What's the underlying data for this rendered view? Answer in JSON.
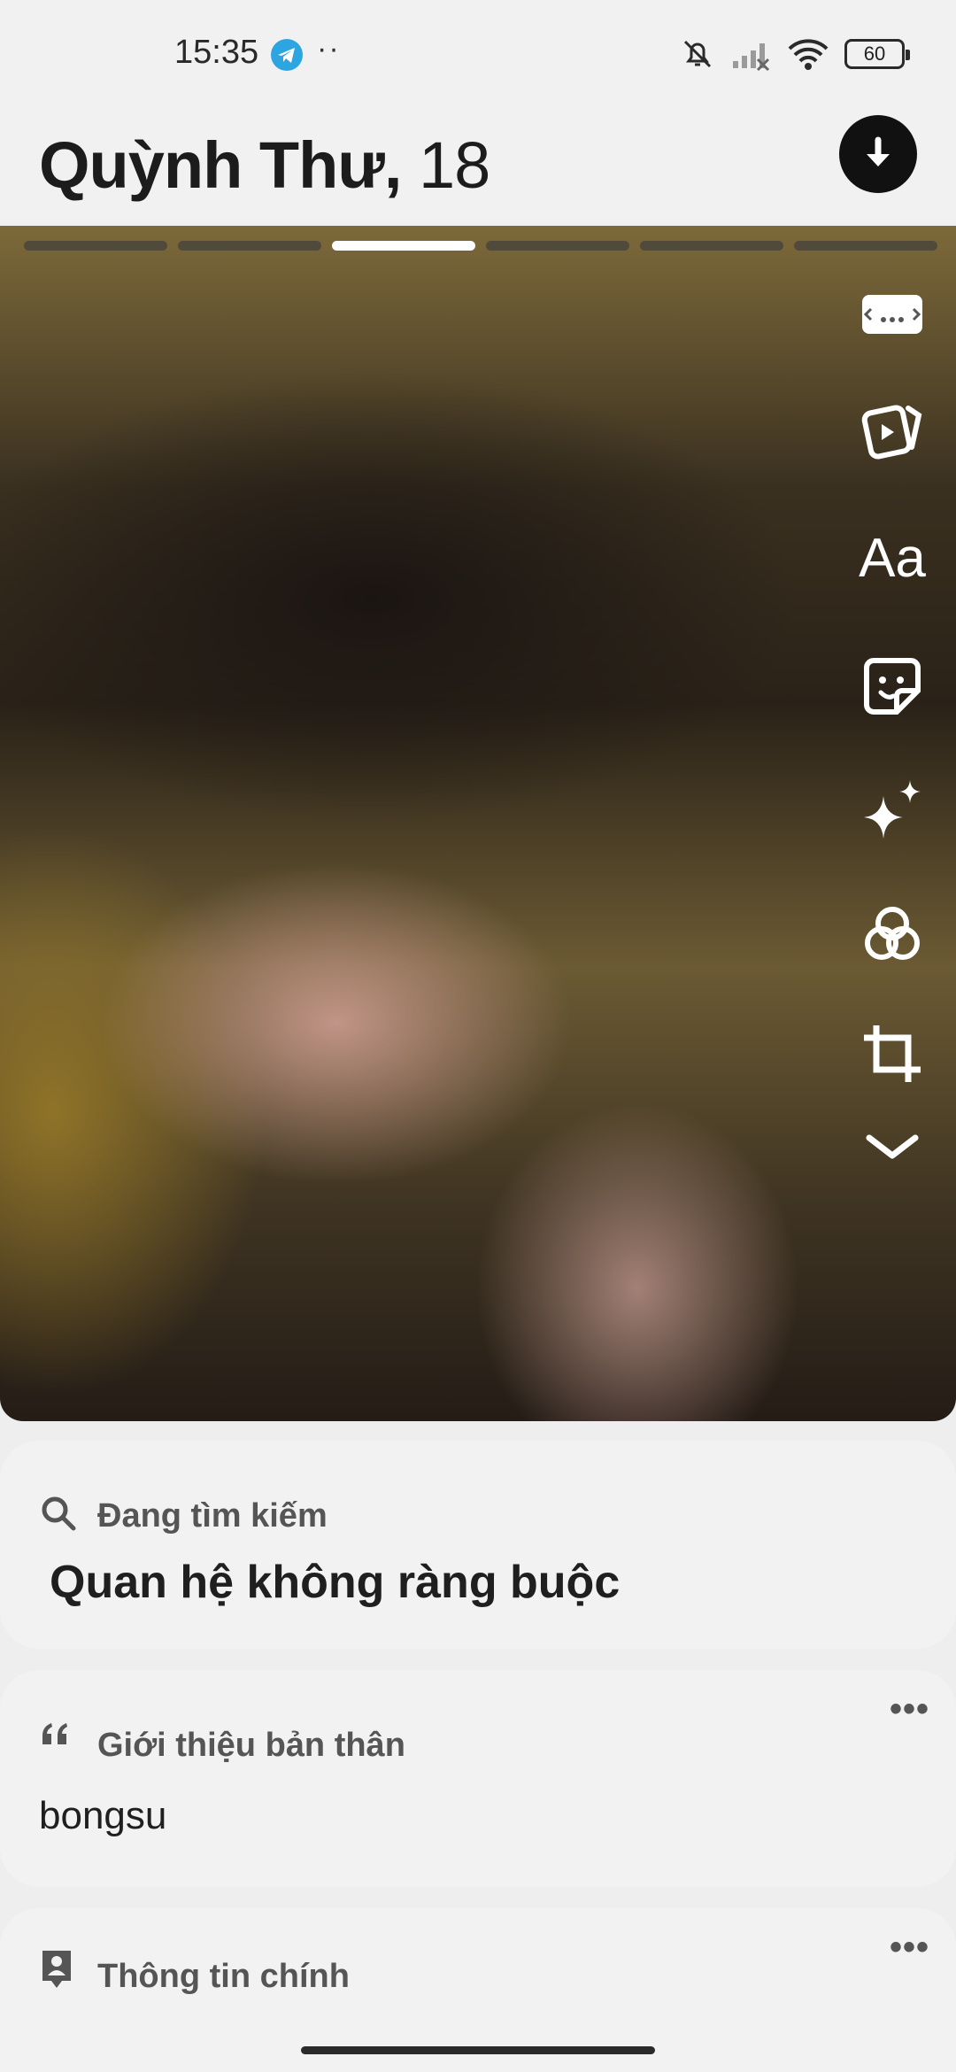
{
  "status_bar": {
    "time": "15:35",
    "telegram_icon": "telegram-icon",
    "more_notifications": "··",
    "battery_level": "60",
    "icons": [
      "silent-icon",
      "signal-icon",
      "wifi-icon",
      "battery-icon"
    ]
  },
  "header": {
    "name": "Quỳnh Thư,",
    "age": "18",
    "download_icon": "arrow-down-icon"
  },
  "photo": {
    "segments_total": 6,
    "active_segment_index": 2,
    "tools": [
      "gallery-icon",
      "reels-icon",
      "text-icon",
      "sticker-icon",
      "sparkle-icon",
      "filters-icon",
      "crop-icon",
      "chevron-down-icon"
    ],
    "text_tool_label": "Aa"
  },
  "looking_for": {
    "label": "Đang tìm kiếm",
    "value": "Quan hệ không ràng buộc"
  },
  "bio": {
    "label": "Giới thiệu bản thân",
    "value": "bongsu",
    "more": "•••"
  },
  "main_info": {
    "label": "Thông tin chính",
    "more": "•••"
  },
  "colors": {
    "background": "#efeeee",
    "card": "#f3f2f2",
    "accent_dark": "#111111"
  }
}
